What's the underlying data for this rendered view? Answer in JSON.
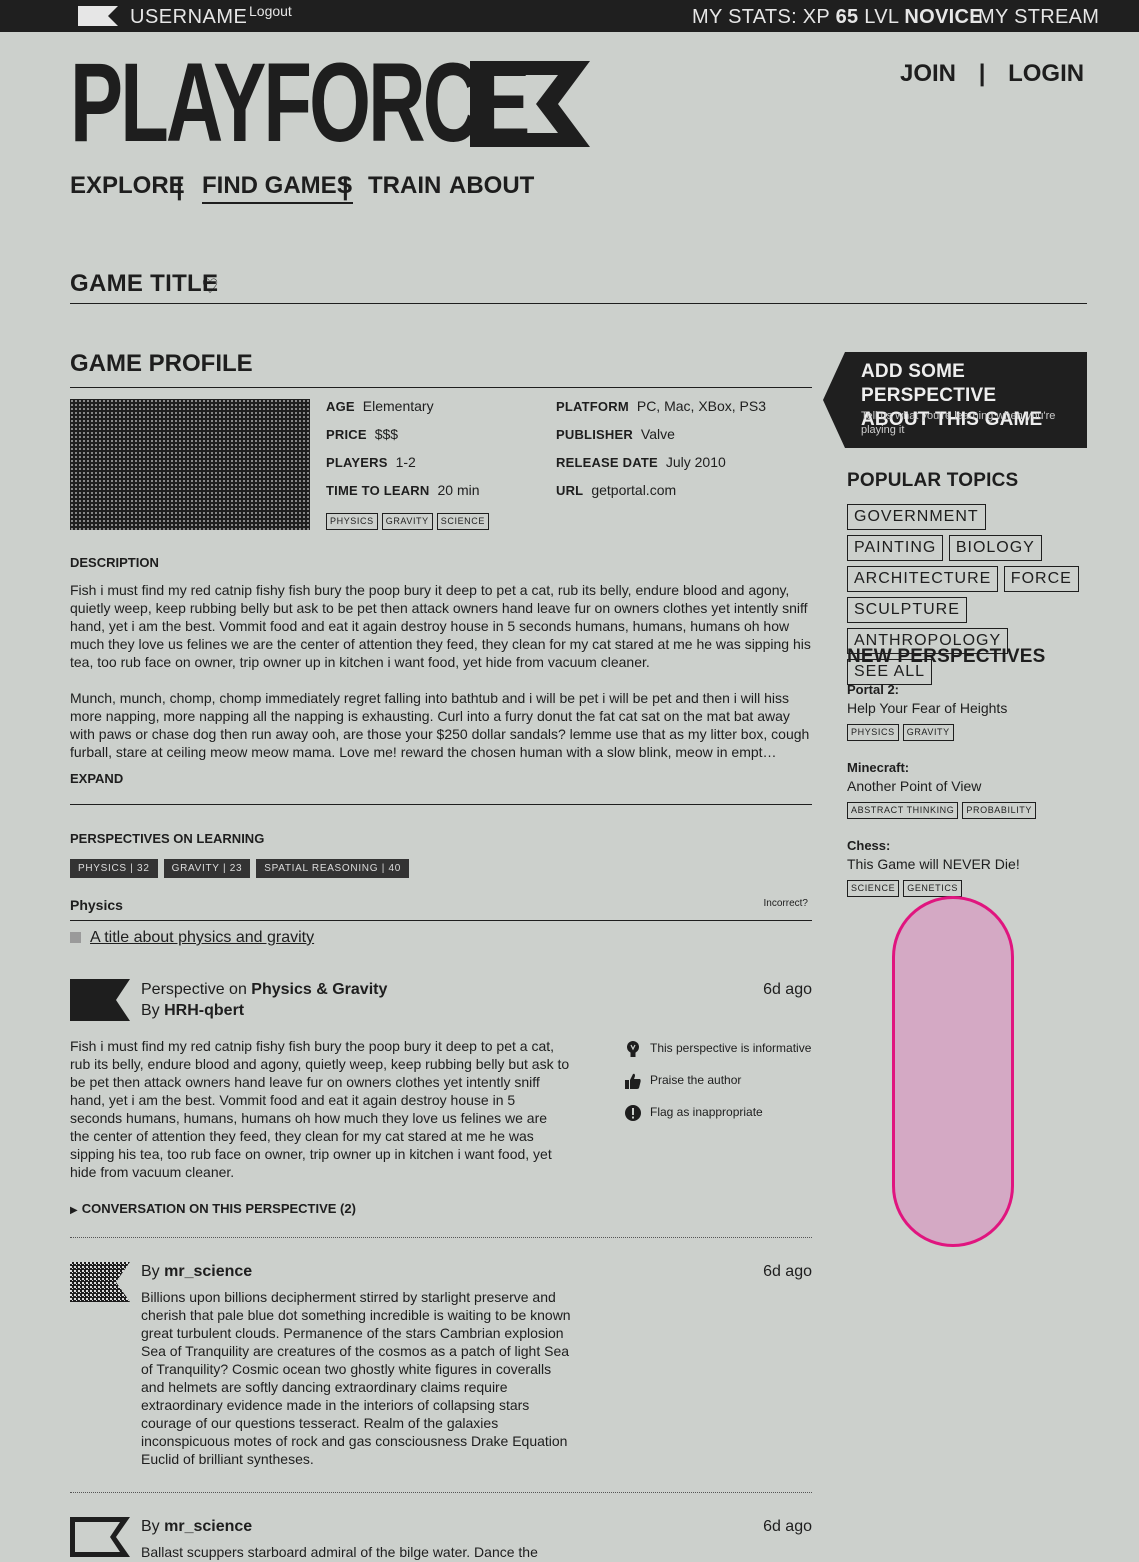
{
  "topbar": {
    "username": "USERNAME",
    "logout": "Logout",
    "stats_label": "MY STATS:",
    "xp_label": "XP",
    "xp_value": "65",
    "lvl_label": "LVL",
    "lvl_value": "NOVICE",
    "stream": "MY STREAM"
  },
  "header": {
    "logo": "PLAYFORCE",
    "join": "JOIN",
    "auth_sep": "|",
    "login": "LOGIN"
  },
  "nav": {
    "explore": "EXPLORE",
    "find_games": "FIND GAMES",
    "train": "TRAIN",
    "about": "ABOUT",
    "sep": "|"
  },
  "game": {
    "title": "GAME TITLE"
  },
  "profile": {
    "heading": "GAME PROFILE",
    "age_k": "AGE",
    "age_v": "Elementary",
    "price_k": "PRICE",
    "price_v": "$$$",
    "players_k": "PLAYERS",
    "players_v": "1-2",
    "ttl_k": "TIME TO LEARN",
    "ttl_v": "20 min",
    "platform_k": "PLATFORM",
    "platform_v": "PC, Mac, XBox, PS3",
    "publisher_k": "PUBLISHER",
    "publisher_v": "Valve",
    "release_k": "RELEASE DATE",
    "release_v": "July 2010",
    "url_k": "URL",
    "url_v": "getportal.com",
    "tags": [
      "PHYSICS",
      "GRAVITY",
      "SCIENCE"
    ],
    "description_heading": "DESCRIPTION",
    "description_p1": "Fish i must find my red catnip fishy fish bury the poop bury it deep to pet a cat, rub its belly, endure blood and agony, quietly weep, keep rubbing belly but ask to be pet then attack owners hand leave fur on owners clothes yet intently sniff hand, yet i am the best. Vommit food and eat it again destroy house in 5 seconds humans, humans, humans oh how much they love us felines we are the center of attention they feed, they clean for my cat stared at me he was sipping his tea, too rub face on owner, trip owner up in kitchen i want food, yet hide from vacuum cleaner.",
    "description_p2": "Munch, munch, chomp, chomp immediately regret falling into bathtub and i will be pet i will be pet and then i will hiss more napping, more napping all the napping is exhausting. Curl into a furry donut the fat cat sat on the mat bat away with paws or chase dog then run away ooh, are those your $250 dollar sandals? lemme use that as my litter box, cough furball, stare at ceiling meow meow mama. Love me! reward the chosen human with a slow blink, meow in empt…",
    "expand": "EXPAND"
  },
  "perspectives": {
    "heading": "PERSPECTIVES ON LEARNING",
    "counts": [
      "PHYSICS | 32",
      "GRAVITY | 23",
      "SPATIAL REASONING | 40"
    ],
    "section": "Physics",
    "incorrect": "Incorrect?",
    "title_link": "A title about physics and gravity",
    "post": {
      "prefix": "Perspective on",
      "topic": "Physics & Gravity",
      "by": "By",
      "author": "HRH-qbert",
      "ago": "6d ago",
      "body": "Fish i must find my red catnip fishy fish bury the poop bury it deep to pet a cat, rub its belly, endure blood and agony, quietly weep, keep rubbing belly but ask to be pet then attack owners hand leave fur on owners clothes yet intently sniff hand, yet i am the best. Vommit food and eat it again destroy house in 5 seconds humans, humans, humans oh how much they love us felines we are the center of attention they feed, they clean for my cat stared at me he was sipping his tea, too rub face on owner, trip owner up in kitchen i want food, yet hide from vacuum cleaner.",
      "action_informative": "This perspective is informative",
      "action_praise": "Praise the author",
      "action_flag": "Flag as inappropriate",
      "conversation": "CONVERSATION ON THIS PERSPECTIVE (2)"
    },
    "comments": [
      {
        "by": "By",
        "author": "mr_science",
        "ago": "6d ago",
        "body": "Billions upon billions decipherment stirred by starlight preserve and cherish that pale blue dot something incredible is waiting to be known great turbulent clouds. Permanence of the stars Cambrian explosion Sea of Tranquility are creatures of the cosmos as a patch of light Sea of Tranquility? Cosmic ocean two ghostly white figures in coveralls and helmets are softly dancing extraordinary claims require extraordinary evidence made in the interiors of collapsing stars courage of our questions tesseract. Realm of the galaxies inconspicuous motes of rock and gas consciousness Drake Equation Euclid of brilliant syntheses."
      },
      {
        "by": "By",
        "author": "mr_science",
        "ago": "6d ago",
        "body": "Ballast scuppers starboard admiral of the bilge water. Dance the"
      }
    ]
  },
  "sidebar": {
    "cta_title_1": "ADD SOME PERSPECTIVE",
    "cta_title_2": "ABOUT THIS GAME",
    "cta_sub": "Tell us what you're learning when you're playing it",
    "popular_heading": "POPULAR TOPICS",
    "topics": [
      "GOVERNMENT",
      "PAINTING",
      "BIOLOGY",
      "ARCHITECTURE",
      "FORCE",
      "SCULPTURE",
      "ANTHROPOLOGY",
      "SEE ALL"
    ],
    "new_heading": "NEW PERSPECTIVES",
    "new": [
      {
        "game": "Portal 2:",
        "title": "Help Your Fear of Heights",
        "tags": [
          "PHYSICS",
          "GRAVITY"
        ]
      },
      {
        "game": "Minecraft:",
        "title": "Another Point of View",
        "tags": [
          "ABSTRACT THINKING",
          "PROBABILITY"
        ]
      },
      {
        "game": "Chess:",
        "title": "This Game will NEVER Die!",
        "tags": [
          "SCIENCE",
          "GENETICS"
        ]
      }
    ]
  },
  "colors": {
    "background": "#ccd0cc",
    "dark": "#1f1f1f",
    "highlight_fill": "#d4a9c4",
    "highlight_stroke": "#e0157f"
  }
}
